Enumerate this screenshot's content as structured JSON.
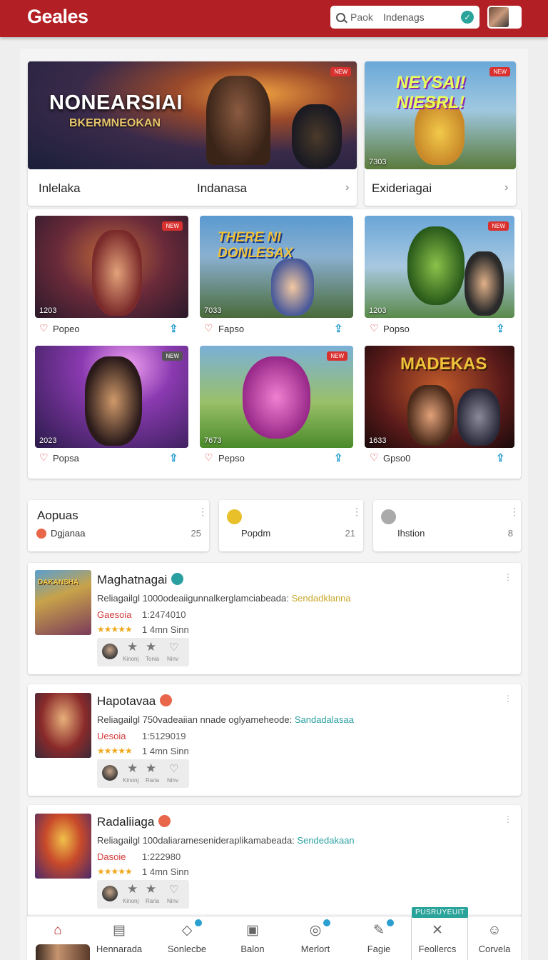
{
  "header": {
    "logo": "Geales",
    "search_placeholder": "Paok",
    "search_value": "Indenags",
    "search_go_icon": "check-circle-icon"
  },
  "hero": {
    "title": "NONEARSIAI",
    "subtitle": "BKERMNEOKAN",
    "badge": "NEW",
    "bar_left": "Inlelaka",
    "bar_center": "Indanasa"
  },
  "featured": {
    "title": "NEYSAI! NIESRL!",
    "badge": "NEW",
    "number": "7303",
    "bar_label": "Exideriagai"
  },
  "grid": [
    {
      "badge": "NEW",
      "number": "1203",
      "label": "Popeo"
    },
    {
      "badge": "",
      "number": "7033",
      "label": "Fapso",
      "art_title": "THERE NI DONLESAX"
    },
    {
      "badge": "NEW",
      "number": "1203",
      "label": "Popso"
    },
    {
      "badge": "NEW",
      "number": "2023",
      "label": "Popsa"
    },
    {
      "badge": "NEW",
      "number": "7673",
      "label": "Pepso"
    },
    {
      "badge": "",
      "number": "1633",
      "label": "Gpso0",
      "art_title": "MADEKAS"
    }
  ],
  "stats": [
    {
      "title": "Aopuas",
      "label": "Dgjanaa",
      "value": "25",
      "color": "#e8674a"
    },
    {
      "title": "",
      "label": "Popdm",
      "value": "21",
      "color": "#e8c02a"
    },
    {
      "title": "",
      "label": "Ihstion",
      "value": "8",
      "color": "#aaaaaa"
    }
  ],
  "list": [
    {
      "title": "Maghatnagai",
      "desc": "Reliagailgl 1000odeaiigunnalkerglamciabeada:",
      "highlight": "Sendadklanna",
      "genre": "Gaesoia",
      "date": "1:2474010",
      "time": "1 4mn Sinn",
      "act1": "Kinonj",
      "act2": "Tonia",
      "act3": "Ninv",
      "thumb_text": "DAKANSHA"
    },
    {
      "title": "Hapotavaa",
      "desc": "Reliagailgl 750vadeaiian nnade oglyameheode:",
      "highlight": "Sandadalasaa",
      "genre": "Uesoia",
      "date": "1:5129019",
      "time": "1 4mn Sinn",
      "act1": "Kinonj",
      "act2": "Raria",
      "act3": "Ninv"
    },
    {
      "title": "Radaliiaga",
      "desc": "Reliagailgl 100daliaramesenideraplikamabeada:",
      "highlight": "Sendedakaan",
      "genre": "Dasoie",
      "date": "1:222980",
      "time": "1 4mn Sinn",
      "act1": "Kinonj",
      "act2": "Raria",
      "act3": "Ninv"
    }
  ],
  "nav": {
    "items": [
      {
        "label": "",
        "icon": "home-icon"
      },
      {
        "label": "Hennarada",
        "icon": "calendar-icon"
      },
      {
        "label": "Sonlecbe",
        "icon": "tag-icon"
      },
      {
        "label": "Balon",
        "icon": "document-icon"
      },
      {
        "label": "Merlort",
        "icon": "compass-icon"
      },
      {
        "label": "Fagie",
        "icon": "edit-icon"
      },
      {
        "label": "Feollercs",
        "icon": "tools-icon"
      },
      {
        "label": "Corvela",
        "icon": "user-icon"
      }
    ],
    "tooltip": "PUSRUYEUIT"
  }
}
